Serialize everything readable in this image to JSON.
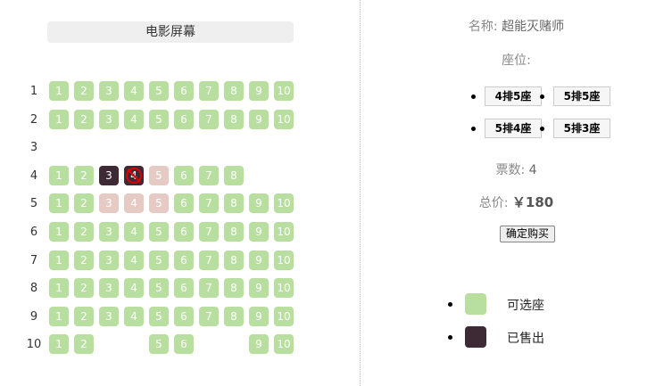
{
  "screen_label": "电影屏幕",
  "rows": [
    {
      "label": "1",
      "seats": [
        {
          "n": "1",
          "s": "available"
        },
        {
          "n": "2",
          "s": "available"
        },
        {
          "n": "3",
          "s": "available"
        },
        {
          "n": "4",
          "s": "available"
        },
        {
          "n": "5",
          "s": "available"
        },
        {
          "n": "6",
          "s": "available"
        },
        {
          "n": "7",
          "s": "available"
        },
        {
          "n": "8",
          "s": "available"
        },
        {
          "n": "9",
          "s": "available"
        },
        {
          "n": "10",
          "s": "available"
        }
      ]
    },
    {
      "label": "2",
      "seats": [
        {
          "n": "1",
          "s": "available"
        },
        {
          "n": "2",
          "s": "available"
        },
        {
          "n": "3",
          "s": "available"
        },
        {
          "n": "4",
          "s": "available"
        },
        {
          "n": "5",
          "s": "available"
        },
        {
          "n": "6",
          "s": "available"
        },
        {
          "n": "7",
          "s": "available"
        },
        {
          "n": "8",
          "s": "available"
        },
        {
          "n": "9",
          "s": "available"
        },
        {
          "n": "10",
          "s": "available"
        }
      ]
    },
    {
      "label": "3",
      "seats": []
    },
    {
      "label": "4",
      "seats": [
        {
          "n": "1",
          "s": "available"
        },
        {
          "n": "2",
          "s": "available"
        },
        {
          "n": "3",
          "s": "sold"
        },
        {
          "n": "4",
          "s": "sold-marked"
        },
        {
          "n": "5",
          "s": "selected"
        },
        {
          "n": "6",
          "s": "available"
        },
        {
          "n": "7",
          "s": "available"
        },
        {
          "n": "8",
          "s": "available"
        }
      ]
    },
    {
      "label": "5",
      "seats": [
        {
          "n": "1",
          "s": "available"
        },
        {
          "n": "2",
          "s": "available"
        },
        {
          "n": "3",
          "s": "selected"
        },
        {
          "n": "4",
          "s": "selected"
        },
        {
          "n": "5",
          "s": "selected"
        },
        {
          "n": "6",
          "s": "available"
        },
        {
          "n": "7",
          "s": "available"
        },
        {
          "n": "8",
          "s": "available"
        },
        {
          "n": "9",
          "s": "available"
        },
        {
          "n": "10",
          "s": "available"
        }
      ]
    },
    {
      "label": "6",
      "seats": [
        {
          "n": "1",
          "s": "available"
        },
        {
          "n": "2",
          "s": "available"
        },
        {
          "n": "3",
          "s": "available"
        },
        {
          "n": "4",
          "s": "available"
        },
        {
          "n": "5",
          "s": "available"
        },
        {
          "n": "6",
          "s": "available"
        },
        {
          "n": "7",
          "s": "available"
        },
        {
          "n": "8",
          "s": "available"
        },
        {
          "n": "9",
          "s": "available"
        },
        {
          "n": "10",
          "s": "available"
        }
      ]
    },
    {
      "label": "7",
      "seats": [
        {
          "n": "1",
          "s": "available"
        },
        {
          "n": "2",
          "s": "available"
        },
        {
          "n": "3",
          "s": "available"
        },
        {
          "n": "4",
          "s": "available"
        },
        {
          "n": "5",
          "s": "available"
        },
        {
          "n": "6",
          "s": "available"
        },
        {
          "n": "7",
          "s": "available"
        },
        {
          "n": "8",
          "s": "available"
        },
        {
          "n": "9",
          "s": "available"
        },
        {
          "n": "10",
          "s": "available"
        }
      ]
    },
    {
      "label": "8",
      "seats": [
        {
          "n": "1",
          "s": "available"
        },
        {
          "n": "2",
          "s": "available"
        },
        {
          "n": "3",
          "s": "available"
        },
        {
          "n": "4",
          "s": "available"
        },
        {
          "n": "5",
          "s": "available"
        },
        {
          "n": "6",
          "s": "available"
        },
        {
          "n": "7",
          "s": "available"
        },
        {
          "n": "8",
          "s": "available"
        },
        {
          "n": "9",
          "s": "available"
        },
        {
          "n": "10",
          "s": "available"
        }
      ]
    },
    {
      "label": "9",
      "seats": [
        {
          "n": "1",
          "s": "available"
        },
        {
          "n": "2",
          "s": "available"
        },
        {
          "n": "3",
          "s": "available"
        },
        {
          "n": "4",
          "s": "available"
        },
        {
          "n": "5",
          "s": "available"
        },
        {
          "n": "6",
          "s": "available"
        },
        {
          "n": "7",
          "s": "available"
        },
        {
          "n": "8",
          "s": "available"
        },
        {
          "n": "9",
          "s": "available"
        },
        {
          "n": "10",
          "s": "available"
        }
      ]
    },
    {
      "label": "10",
      "seats": [
        {
          "n": "1",
          "s": "available"
        },
        {
          "n": "2",
          "s": "available"
        },
        {
          "n": "5",
          "s": "available"
        },
        {
          "n": "6",
          "s": "available"
        },
        {
          "n": "9",
          "s": "available"
        },
        {
          "n": "10",
          "s": "available"
        }
      ]
    }
  ],
  "info": {
    "name_label": "名称:",
    "name_value": "超能灭赌师",
    "seat_label": "座位:",
    "seats": [
      "4排5座",
      "5排5座",
      "5排4座",
      "5排3座"
    ],
    "count_label": "票数:",
    "count_value": "4",
    "price_label": "总价:",
    "price_value": "￥180",
    "buy_button": "确定购买"
  },
  "legend": [
    {
      "label": "可选座",
      "color": "#b9dfa0"
    },
    {
      "label": "已售出",
      "color": "#3e2a34"
    }
  ],
  "colors": {
    "available": "#b9dfa0",
    "sold": "#3e2a34",
    "selected": "#e6cbc4"
  }
}
